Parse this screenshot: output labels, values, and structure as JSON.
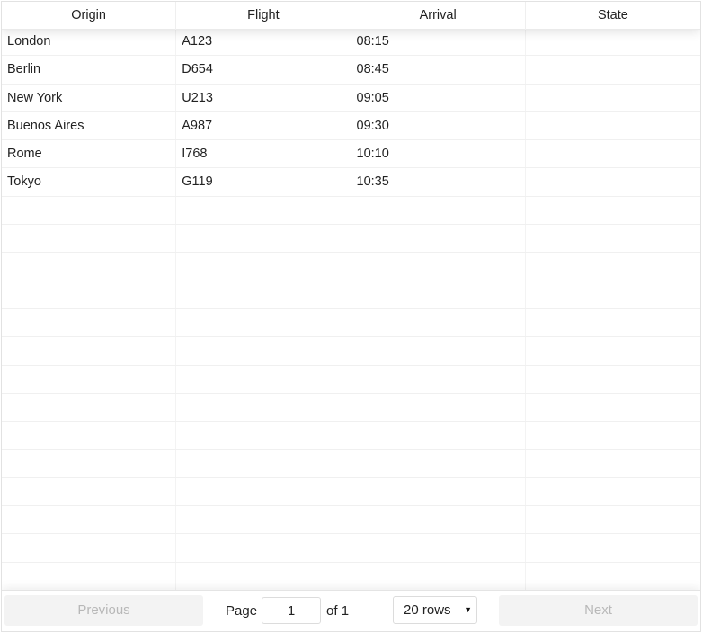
{
  "table": {
    "columns": [
      "Origin",
      "Flight",
      "Arrival",
      "State"
    ],
    "rows": [
      [
        "London",
        "A123",
        "08:15",
        ""
      ],
      [
        "Berlin",
        "D654",
        "08:45",
        ""
      ],
      [
        "New York",
        "U213",
        "09:05",
        ""
      ],
      [
        "Buenos Aires",
        "A987",
        "09:30",
        ""
      ],
      [
        "Rome",
        "I768",
        "10:10",
        ""
      ],
      [
        "Tokyo",
        "G119",
        "10:35",
        ""
      ],
      [
        "",
        "",
        "",
        ""
      ],
      [
        "",
        "",
        "",
        ""
      ],
      [
        "",
        "",
        "",
        ""
      ],
      [
        "",
        "",
        "",
        ""
      ],
      [
        "",
        "",
        "",
        ""
      ],
      [
        "",
        "",
        "",
        ""
      ],
      [
        "",
        "",
        "",
        ""
      ],
      [
        "",
        "",
        "",
        ""
      ],
      [
        "",
        "",
        "",
        ""
      ],
      [
        "",
        "",
        "",
        ""
      ],
      [
        "",
        "",
        "",
        ""
      ],
      [
        "",
        "",
        "",
        ""
      ],
      [
        "",
        "",
        "",
        ""
      ],
      [
        "",
        "",
        "",
        ""
      ]
    ]
  },
  "pagination": {
    "previous_label": "Previous",
    "next_label": "Next",
    "page_label": "Page",
    "current_page": "1",
    "of_label": "of 1",
    "rows_option": "20 rows"
  }
}
